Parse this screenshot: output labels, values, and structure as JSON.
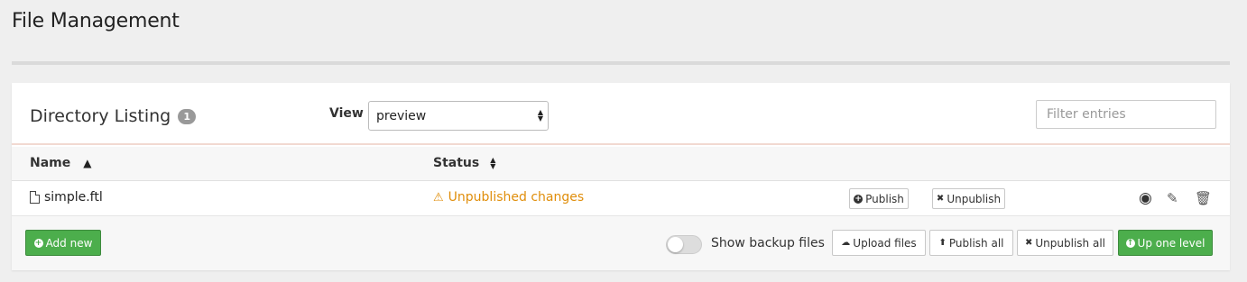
{
  "page": {
    "title": "File Management"
  },
  "directory": {
    "title": "Directory Listing",
    "count": "1",
    "view_label": "View",
    "view_value": "preview",
    "filter_placeholder": "Filter entries"
  },
  "table": {
    "columns": {
      "name": "Name",
      "status": "Status"
    },
    "rows": [
      {
        "name": "simple.ftl",
        "status": "Unpublished changes",
        "publish_label": "Publish",
        "unpublish_label": "Unpublish"
      }
    ]
  },
  "footer": {
    "add_new": "Add new",
    "show_backup_files": "Show backup files",
    "upload_files": "Upload files",
    "publish_all": "Publish all",
    "unpublish_all": "Unpublish all",
    "up_one_level": "Up one level"
  },
  "colors": {
    "green": "#4cae4c",
    "warning": "#e08e0b"
  },
  "icons": {
    "file": "file-icon",
    "warning": "warning-icon",
    "preview": "eye-icon",
    "edit": "edit-icon",
    "delete": "trash-icon",
    "sort_asc": "sort-asc-icon",
    "sort": "sort-icon"
  }
}
